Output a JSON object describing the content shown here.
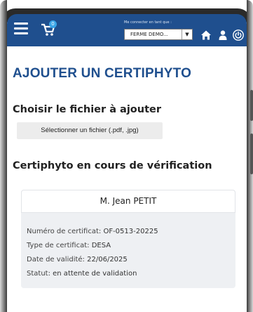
{
  "header": {
    "cart_badge": "0",
    "farm_select_label": "Me connecter en tant que :",
    "farm_select_value": "FERME DEMO..."
  },
  "page": {
    "title": "AJOUTER UN CERTIPHYTO",
    "file_section_title": "Choisir le fichier à ajouter",
    "file_button_label": "Sélectionner un fichier (.pdf, .jpg)",
    "pending_section_title": "Certiphyto en cours de vérification"
  },
  "certificate": {
    "holder": "M. Jean PETIT",
    "fields": [
      {
        "label": "Numéro de certificat:",
        "value": "OF-0513-20225"
      },
      {
        "label": "Type de certificat:",
        "value": "DESA"
      },
      {
        "label": "Date de validité:",
        "value": "22/06/2025"
      },
      {
        "label": "Statut:",
        "value": "en attente de validation"
      }
    ]
  },
  "colors": {
    "brand_blue": "#1f4f8e",
    "badge_blue": "#3aa6e8"
  }
}
